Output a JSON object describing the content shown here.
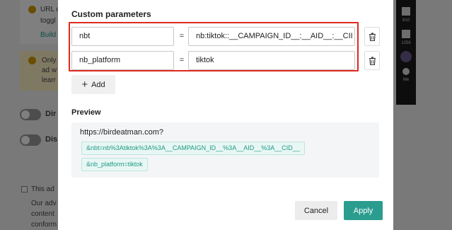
{
  "background": {
    "card_line1": "URL c",
    "card_line2": "toggl",
    "card_link": "Build",
    "warn_line1": "Only",
    "warn_line2": "ad w",
    "warn_line3": "learr",
    "toggle1_label": "Dir",
    "toggle2_label": "Dis",
    "checkbox_text": "This ad",
    "para_line1": "Our adv",
    "para_line2": "content",
    "para_line3": "conform",
    "side_count1": "810",
    "side_count2": "1256",
    "side_label": "Me"
  },
  "modal": {
    "custom_params_title": "Custom parameters",
    "params": [
      {
        "key": "nbt",
        "value": "nb:tiktok::__CAMPAIGN_ID__:__AID__:__CII"
      },
      {
        "key": "nb_platform",
        "value": "tiktok"
      }
    ],
    "equals_sign": "=",
    "add_label": "Add",
    "preview_title": "Preview",
    "preview_url": "https://birdeatman.com?",
    "preview_tags": [
      "&nbt=nb%3Atiktok%3A%3A__CAMPAIGN_ID__%3A__AID__%3A__CID__",
      "&nb_platform=tiktok"
    ],
    "cancel_label": "Cancel",
    "apply_label": "Apply"
  },
  "colors": {
    "accent": "#2a9d8f",
    "highlight": "#e0291f",
    "tag_text": "#1d9a86"
  }
}
